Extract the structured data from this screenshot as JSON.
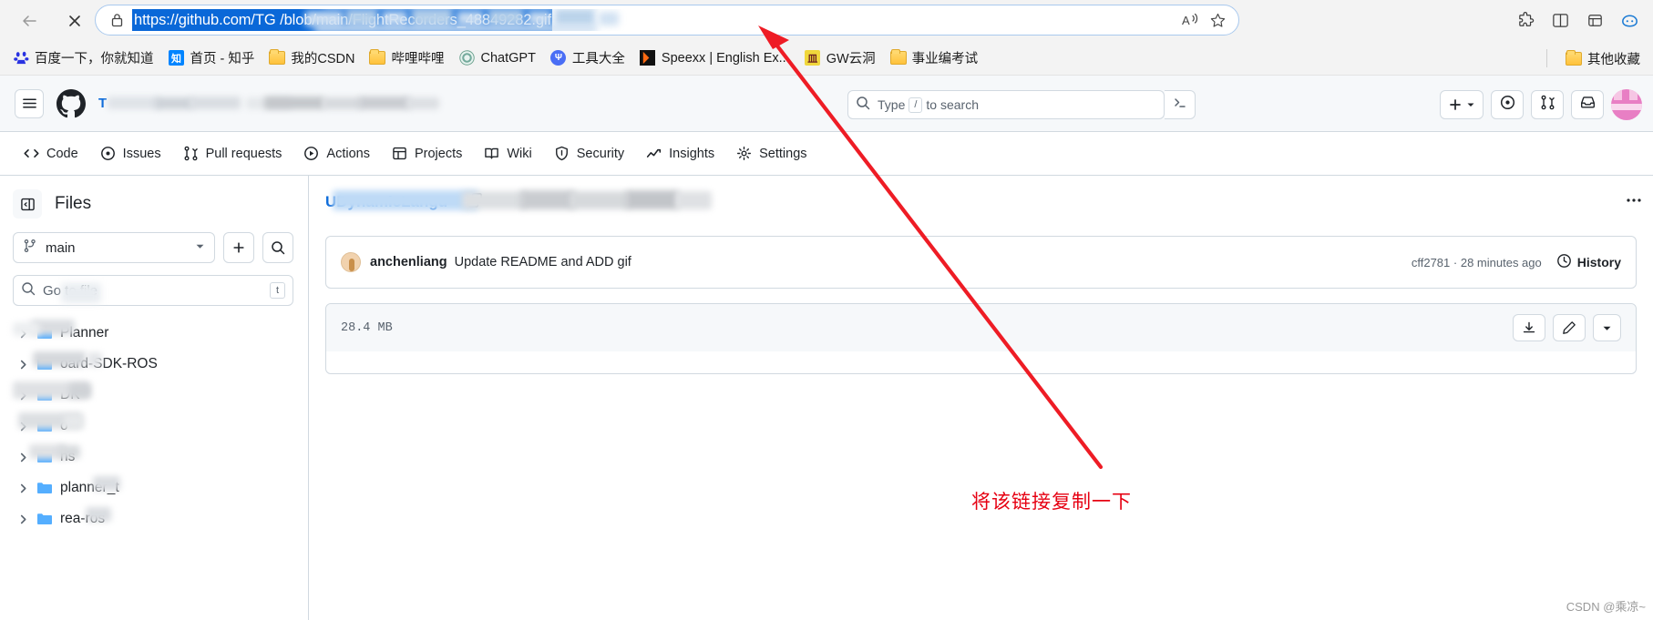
{
  "browser": {
    "back_label": "Back",
    "close_label": "Stop",
    "url": "https://github.com/TG                                    /blob/main/FlightRecorders_48849282.gif",
    "url_visible_prefix": "https://github.com/TG",
    "url_visible_suffix": "/blob/main/FlightRecorders_48849282.gif",
    "lock_icon": "lock-icon",
    "read_aloud_icon": "read-aloud-icon",
    "favorite_icon": "star-icon",
    "toolbar_icons": [
      "puzzle-extensions-icon",
      "split-screen-icon",
      "collections-icon",
      "copilot-icon"
    ]
  },
  "bookmarks": {
    "items": [
      {
        "label": "百度一下，你就知道",
        "icon": "baidu-icon"
      },
      {
        "label": "首页 - 知乎",
        "icon": "zhihu-icon"
      },
      {
        "label": "我的CSDN",
        "icon": "folder-icon"
      },
      {
        "label": "哔哩哔哩",
        "icon": "folder-icon"
      },
      {
        "label": "ChatGPT",
        "icon": "chatgpt-icon"
      },
      {
        "label": "工具大全",
        "icon": "tools-icon"
      },
      {
        "label": "Speexx | English Ex...",
        "icon": "speexx-icon"
      },
      {
        "label": "GW云洞",
        "icon": "gw-icon"
      },
      {
        "label": "事业编考试",
        "icon": "folder-icon"
      }
    ],
    "other_favorites": {
      "label": "其他收藏",
      "icon": "folder-icon"
    }
  },
  "github": {
    "header": {
      "menu_icon": "hamburger-icon",
      "logo_icon": "github-mark-icon",
      "repo_prefix": "T",
      "search_placeholder": "Type",
      "search_key": "/",
      "search_suffix": "to search",
      "command_palette_icon": "terminal-icon",
      "create_new_label": "+",
      "issues_icon": "issue-opened-icon",
      "pull_requests_icon": "git-pull-request-icon",
      "inbox_icon": "inbox-icon",
      "avatar": "user-avatar"
    },
    "nav_tabs": [
      {
        "label": "Code",
        "icon": "code-icon"
      },
      {
        "label": "Issues",
        "icon": "issue-opened-icon"
      },
      {
        "label": "Pull requests",
        "icon": "git-pull-request-icon"
      },
      {
        "label": "Actions",
        "icon": "play-icon"
      },
      {
        "label": "Projects",
        "icon": "table-icon"
      },
      {
        "label": "Wiki",
        "icon": "book-icon"
      },
      {
        "label": "Security",
        "icon": "shield-icon"
      },
      {
        "label": "Insights",
        "icon": "graph-icon"
      },
      {
        "label": "Settings",
        "icon": "gear-icon"
      }
    ],
    "sidebar": {
      "files_title": "Files",
      "toggle_icon": "sidebar-collapse-icon",
      "branch": "main",
      "branch_icon": "git-branch-icon",
      "add_file_icon": "plus-icon",
      "search_files_icon": "search-icon",
      "go_to_file_placeholder": "Go to file",
      "go_to_file_key": "t",
      "tree": [
        {
          "label": "Planner",
          "icon": "directory-icon",
          "redact_width": 84
        },
        {
          "label": "oard-SDK-ROS",
          "icon": "directory-icon",
          "redact_width": 72
        },
        {
          "label": "DK",
          "icon": "directory-icon",
          "redact_width": 118
        },
        {
          "label": "o",
          "icon": "directory-icon",
          "redact_width": 110
        },
        {
          "label": "ns",
          "icon": "directory-icon",
          "redact_width": 78
        },
        {
          "label": "planner_t",
          "icon": "directory-icon",
          "redact_width": 0
        },
        {
          "label": "rea-ros",
          "icon": "directory-icon",
          "redact_width": 0
        }
      ]
    },
    "main": {
      "file_title_prefix": "U",
      "file_title_visible": "DynamicLangu",
      "copy_path_icon": "copy-icon",
      "kebab_icon": "kebab-horizontal-icon",
      "commit": {
        "author": "anchenliang",
        "message": "Update README and ADD gif",
        "sha": "cff2781",
        "time": "28 minutes ago",
        "separator": "·",
        "history_label": "History",
        "history_icon": "history-icon"
      },
      "file": {
        "size": "28.4 MB",
        "download_icon": "download-icon",
        "edit_icon": "pencil-icon",
        "more_icon": "chevron-down-icon"
      }
    }
  },
  "annotation": {
    "text": "将该链接复制一下",
    "color": "#e60012",
    "arrow": "red-arrow-pointing-to-url-bar"
  },
  "watermark": "CSDN @乘凉~"
}
